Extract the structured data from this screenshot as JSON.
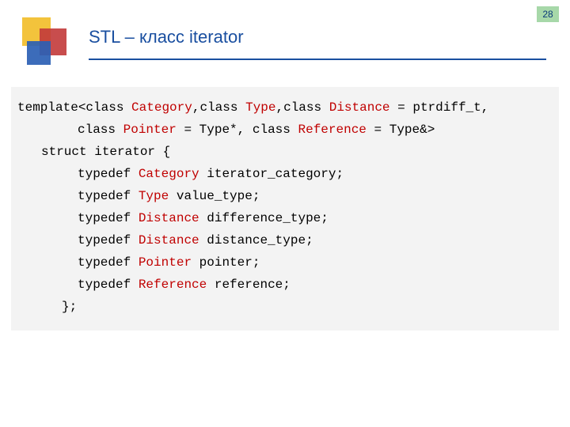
{
  "page_number": "28",
  "title": "STL – класс iterator",
  "code": {
    "tmpl": "template",
    "lt": "<",
    "gt": ">",
    "class_kw": "class",
    "Category": "Category",
    "Type": "Type",
    "Distance": "Distance",
    "Pointer": "Pointer",
    "Reference": "Reference",
    "eq_ptrdiff": " = ptrdiff_t,",
    "comma_class": ",class",
    "comma": ",",
    "eq_typestar": " = Type*",
    "comma_class_sp": ", class",
    "eq_typeamp": " = Type&",
    "struct_line": "struct iterator {",
    "typedef_kw": "typedef",
    "iterator_category": " iterator_category;",
    "value_type": " value_type;",
    "difference_type": " difference_type;",
    "distance_type": " distance_type;",
    "pointer_lbl": " pointer;",
    "reference_lbl": " reference;",
    "close": "};"
  }
}
